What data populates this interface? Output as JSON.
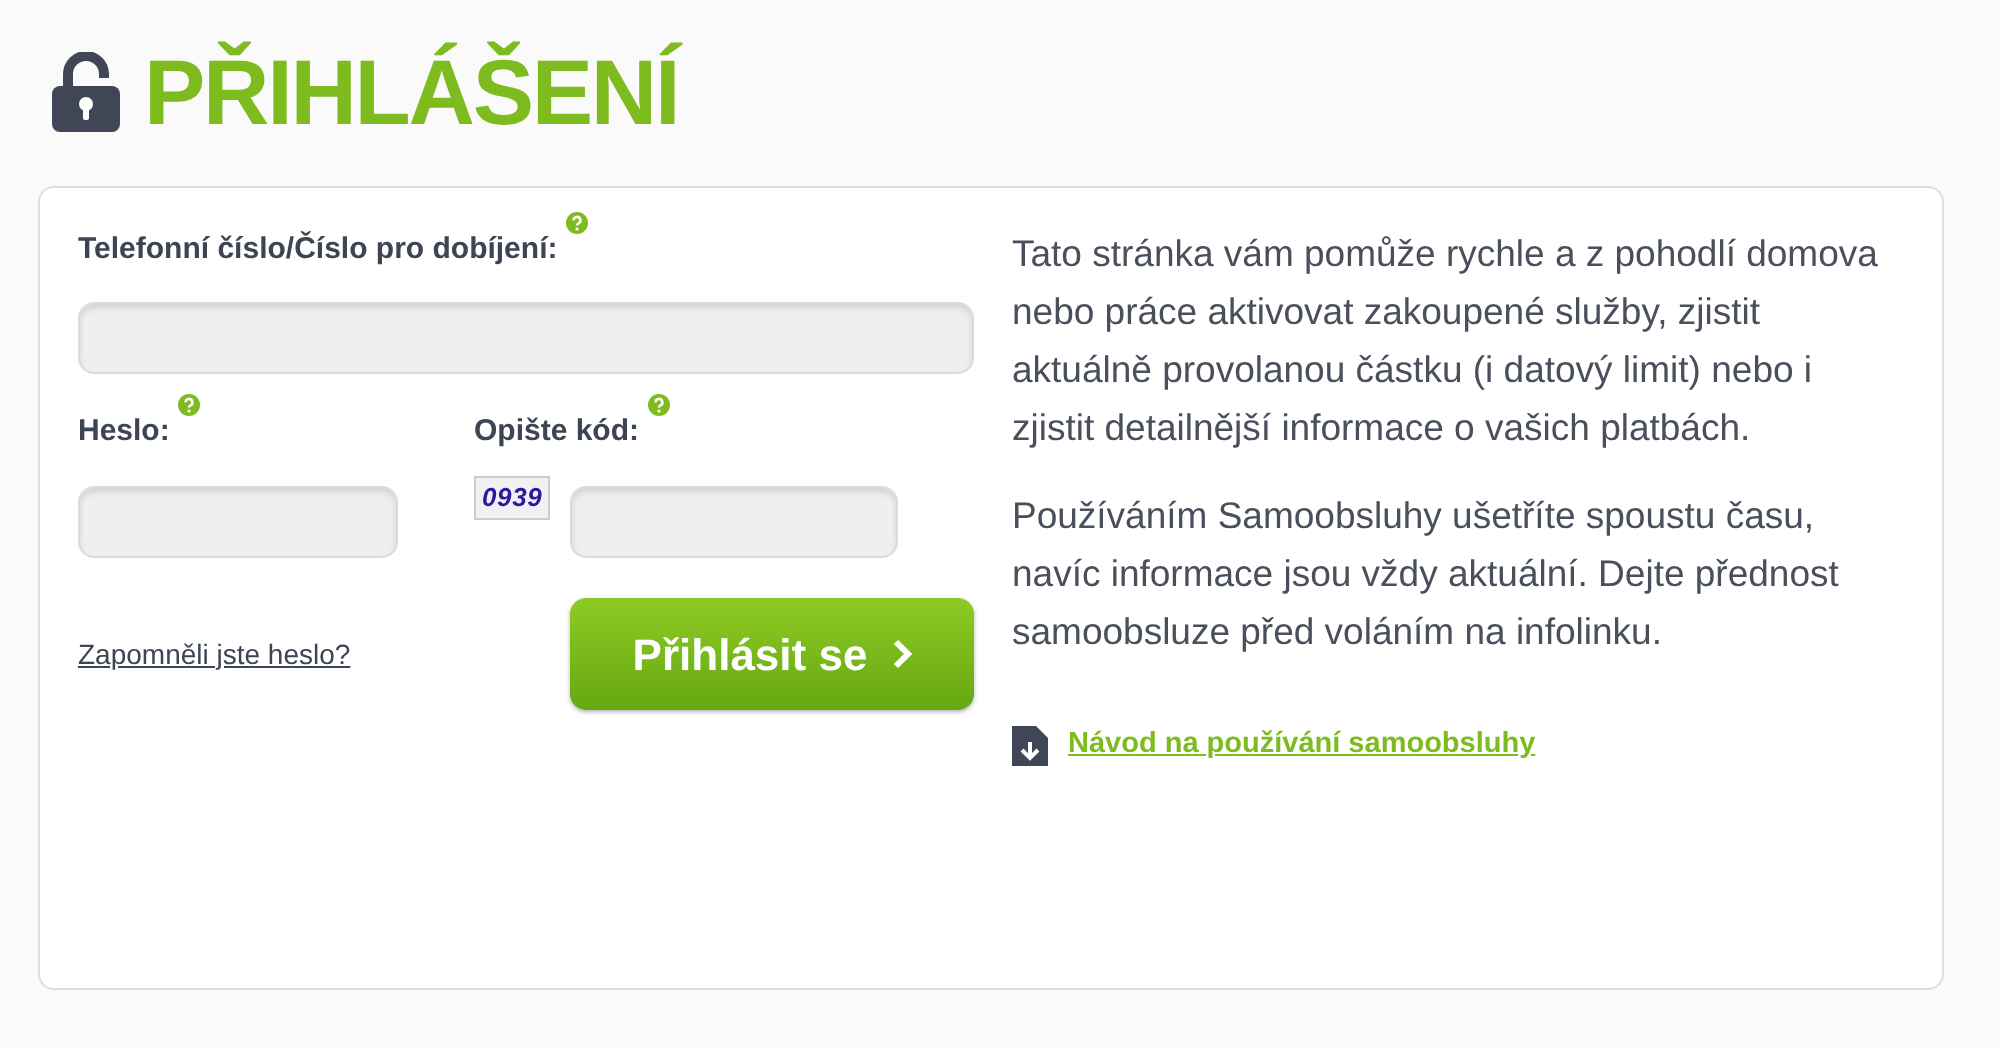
{
  "title": "PŘIHLÁŠENÍ",
  "form": {
    "phone": {
      "label": "Telefonní číslo/Číslo pro dobíjení:"
    },
    "password": {
      "label": "Heslo:"
    },
    "captcha": {
      "label": "Opište kód:",
      "code": "0939"
    },
    "forgot_link": "Zapomněli jste heslo?",
    "submit": "Přihlásit se"
  },
  "info": {
    "paragraphs": [
      "Tato stránka vám pomůže rychle a z pohodlí domova nebo práce aktivovat zakoupené služby, zjistit aktuálně provolanou částku (i datový limit) nebo i zjistit detailnější informace o vašich platbách.",
      "Používáním Samoobsluhy ušetříte spoustu času, navíc informace jsou vždy aktuální. Dejte přednost samoobsluze před voláním na infolinku."
    ],
    "guide_link": "Návod na používání samoobsluhy"
  }
}
